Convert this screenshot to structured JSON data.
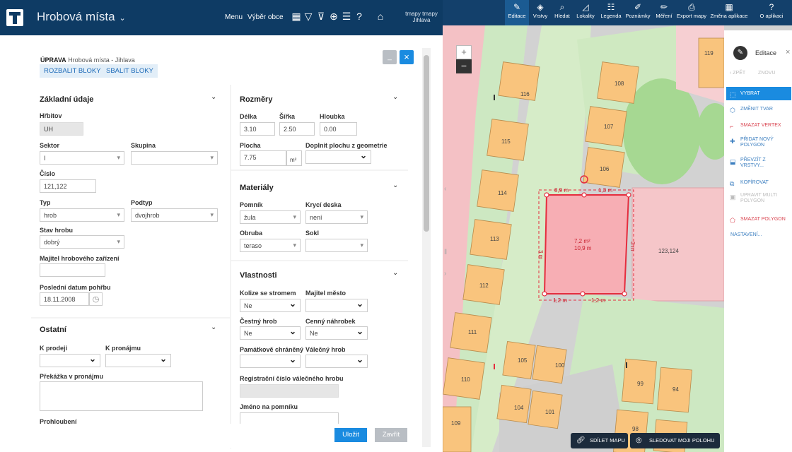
{
  "app": {
    "title": "Hrobová místa",
    "menu": "Menu",
    "select_municipality": "Výběr obce",
    "tmapy_line1": "tmapy tmapy",
    "tmapy_line2": "Jihlava"
  },
  "dialog": {
    "mode": "ÚPRAVA",
    "subtitle": "Hrobová místa - Jihlava",
    "expand_blocks": "ROZBALIT BLOKY",
    "collapse_blocks": "SBALIT BLOKY",
    "save": "Uložit",
    "close": "Zavřít"
  },
  "basic": {
    "title": "Základní údaje",
    "cemetery_label": "Hřbitov",
    "cemetery_value": "UH",
    "sector_label": "Sektor",
    "sector_value": "I",
    "group_label": "Skupina",
    "group_value": "",
    "number_label": "Číslo",
    "number_value": "121,122",
    "type_label": "Typ",
    "type_value": "hrob",
    "subtype_label": "Podtyp",
    "subtype_value": "dvojhrob",
    "state_label": "Stav hrobu",
    "state_value": "dobrý",
    "owner_label": "Majitel hrobového zařízení",
    "owner_value": "",
    "burial_label": "Poslední datum pohřbu",
    "burial_value": "18.11.2008"
  },
  "other": {
    "title": "Ostatní",
    "for_sale_label": "K prodeji",
    "for_rent_label": "K pronájmu",
    "obstacle_label": "Překážka v pronájmu",
    "deepening_label": "Prohloubení"
  },
  "dims": {
    "title": "Rozměry",
    "length_label": "Délka",
    "length_value": "3.10",
    "width_label": "Šířka",
    "width_value": "2.50",
    "depth_label": "Hloubka",
    "depth_value": "0.00",
    "area_label": "Plocha",
    "area_value": "7.75",
    "area_unit": "m²",
    "fill_area_label": "Doplnit plochu z geometrie"
  },
  "materials": {
    "title": "Materiály",
    "monument_label": "Pomník",
    "monument_value": "žula",
    "cover_label": "Krycí deska",
    "cover_value": "není",
    "border_label": "Obruba",
    "border_value": "teraso",
    "base_label": "Sokl",
    "base_value": ""
  },
  "props": {
    "title": "Vlastnosti",
    "tree_collision_label": "Kolize se stromem",
    "tree_collision_value": "Ne",
    "city_owner_label": "Majitel město",
    "honor_label": "Čestný hrob",
    "honor_value": "Ne",
    "valuable_label": "Cenný náhrobek",
    "valuable_value": "Ne",
    "heritage_label": "Památkově chráněný",
    "war_label": "Válečný hrob",
    "war_reg_label": "Registrační číslo válečného hrobu",
    "monument_name_label": "Jméno na pomníku"
  },
  "map": {
    "toolbar": [
      "Editace",
      "Vrstvy",
      "Hledat",
      "Lokality",
      "Legenda",
      "Poznámky",
      "Měření",
      "Export mapy",
      "Změna aplikace",
      "O aplikaci"
    ],
    "edit_title": "Editace",
    "undo": "ZPĚT",
    "redo": "ZNOVU",
    "tools": [
      "VYBRAT",
      "ZMĚNIT TVAR",
      "SMAZAT VERTEX",
      "PŘIDAT NOVÝ POLYGON",
      "PŘEVZÍT Z VRSTVY...",
      "KOPÍROVAT",
      "UPRAVIT MULTI POLYGON",
      "SMAZAT POLYGON",
      "NASTAVENÍ..."
    ],
    "share": "SDÍLET MAPU",
    "track": "SLEDOVAT MOJI POLOHU",
    "grave_numbers": [
      "119",
      "116",
      "108",
      "107",
      "115",
      "106",
      "114",
      "113",
      "112",
      "111",
      "110",
      "105",
      "100",
      "104",
      "101",
      "109",
      "98",
      "99",
      "94",
      "123,124"
    ],
    "area_label_1": "7,2 m²",
    "area_label_2": "10,9 m",
    "dim_top_left": "8,9 m",
    "dim_top_right": "1,3 m",
    "dim_bottom_left": "1,2 m",
    "dim_bottom_right": "1,2 m",
    "dim_left": "3 m",
    "dim_right": "3 m"
  },
  "colors": {
    "header": "#0e3b64",
    "accent": "#1a8be0",
    "grave_fill": "#f9c47d",
    "selected": "#e52d3e"
  }
}
